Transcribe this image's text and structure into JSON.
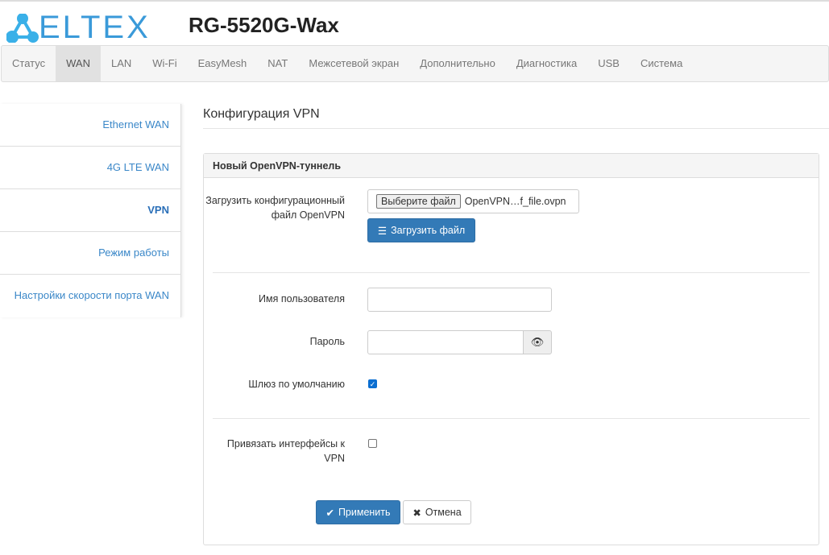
{
  "header": {
    "logo": "ELTEX",
    "title": "RG-5520G-Wax"
  },
  "nav": [
    "Статус",
    "WAN",
    "LAN",
    "Wi-Fi",
    "EasyMesh",
    "NAT",
    "Межсетевой экран",
    "Дополнительно",
    "Диагностика",
    "USB",
    "Система"
  ],
  "nav_active": 1,
  "sidebar": [
    "Ethernet WAN",
    "4G LTE WAN",
    "VPN",
    "Режим работы",
    "Настройки скорости порта WAN"
  ],
  "sidebar_active": 2,
  "page_title": "Конфигурация VPN",
  "panel": {
    "title": "Новый OpenVPN-туннель",
    "upload_label": "Загрузить конфигурационный файл OpenVPN",
    "choose_file": "Выберите файл",
    "file_name": "OpenVPN…f_file.ovpn",
    "upload_button": "Загрузить файл",
    "username_label": "Имя пользователя",
    "username_value": "",
    "password_label": "Пароль",
    "password_value": "",
    "gateway_label": "Шлюз по умолчанию",
    "gateway_checked": true,
    "bind_label": "Привязать интерфейсы к VPN",
    "bind_checked": false,
    "apply": "Применить",
    "cancel": "Отмена"
  }
}
